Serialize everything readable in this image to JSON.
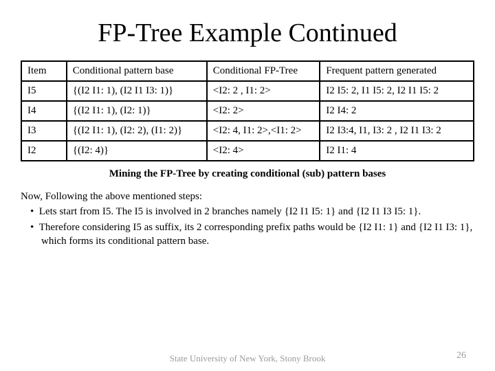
{
  "title": "FP-Tree Example Continued",
  "table": {
    "headers": [
      "Item",
      "Conditional pattern base",
      "Conditional FP-Tree",
      "Frequent pattern generated"
    ],
    "rows": [
      {
        "item": "I5",
        "cpb": "{(I2 I1: 1), (I2 I1 I3: 1)}",
        "cfp": "<I2: 2 , I1: 2>",
        "freq": "I2 I5: 2, I1 I5: 2, I2 I1 I5: 2"
      },
      {
        "item": "I4",
        "cpb": "{(I2 I1: 1), (I2: 1)}",
        "cfp": "<I2: 2>",
        "freq": "I2 I4: 2"
      },
      {
        "item": "I3",
        "cpb": "{(I2 I1: 1), (I2: 2), (I1: 2)}",
        "cfp": "<I2: 4, I1: 2>,<I1: 2>",
        "freq": "I2 I3:4, I1, I3: 2 , I2 I1 I3: 2"
      },
      {
        "item": "I2",
        "cpb": "{(I2: 4)}",
        "cfp": "<I2: 4>",
        "freq": "I2 I1: 4"
      }
    ]
  },
  "caption": "Mining the FP-Tree by creating conditional (sub) pattern bases",
  "body": {
    "lead": "Now, Following the above mentioned steps:",
    "bullet1": "Lets start from I5. The I5 is involved in 2 branches namely {I2 I1 I5: 1} and {I2 I1 I3 I5: 1}.",
    "bullet2": "Therefore considering I5 as suffix, its 2 corresponding prefix paths would be {I2 I1: 1} and {I2 I1 I3: 1}, which forms its conditional pattern base."
  },
  "footer": {
    "org": "State University of New York, Stony Brook",
    "page": "26"
  }
}
